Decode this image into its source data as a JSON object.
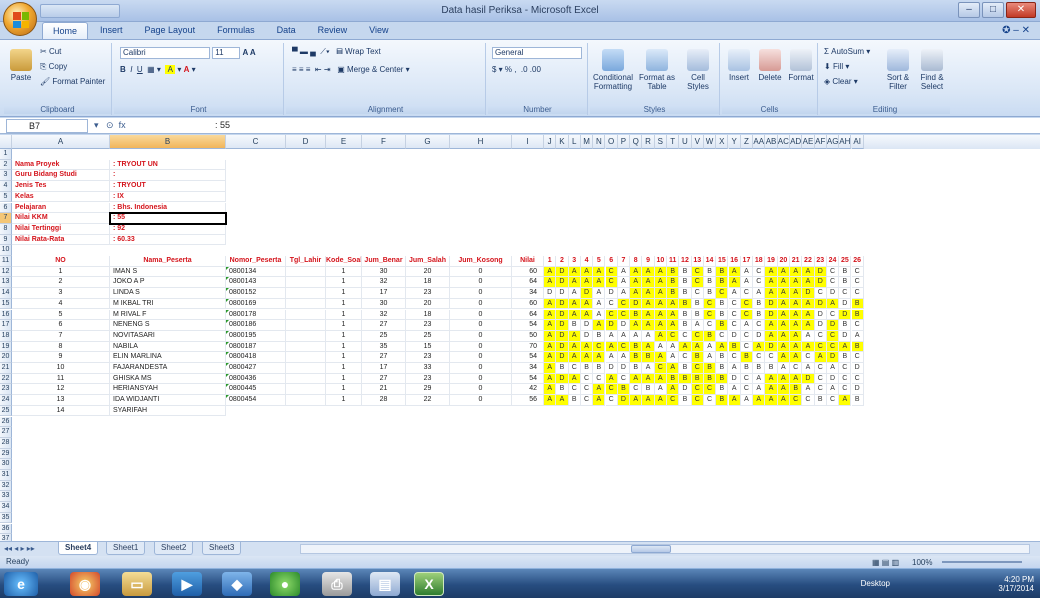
{
  "window": {
    "title": "Data hasil Periksa - Microsoft Excel",
    "controls": [
      "–",
      "□",
      "✕"
    ]
  },
  "ribbon": {
    "tabs": [
      "Home",
      "Insert",
      "Page Layout",
      "Formulas",
      "Data",
      "Review",
      "View"
    ],
    "active_tab": "Home",
    "help": "✪ – ✕",
    "clipboard": {
      "paste": "Paste",
      "cut": "Cut",
      "copy": "Copy",
      "format_painter": "Format Painter",
      "label": "Clipboard"
    },
    "font": {
      "name": "Calibri",
      "size": "11",
      "label": "Font"
    },
    "alignment": {
      "wrap": "Wrap Text",
      "merge": "Merge & Center",
      "label": "Alignment"
    },
    "number": {
      "format": "General",
      "label": "Number"
    },
    "styles": {
      "conditional": "Conditional Formatting",
      "format_table": "Format as Table",
      "cell_styles": "Cell Styles",
      "label": "Styles"
    },
    "cells": {
      "insert": "Insert",
      "delete": "Delete",
      "format": "Format",
      "label": "Cells"
    },
    "editing": {
      "autosum": "AutoSum",
      "fill": "Fill",
      "clear": "Clear",
      "sort": "Sort & Filter",
      "find": "Find & Select",
      "label": "Editing"
    }
  },
  "formula_bar": {
    "name_box": "B7",
    "fx": "fx",
    "value": ": 55"
  },
  "columns": [
    "A",
    "B",
    "C",
    "D",
    "E",
    "F",
    "G",
    "H",
    "I",
    "J",
    "K",
    "L",
    "M",
    "N",
    "O",
    "P",
    "Q",
    "R",
    "S",
    "T",
    "U",
    "V",
    "W",
    "X",
    "Y",
    "Z",
    "AA",
    "AB",
    "AC",
    "AD",
    "AE",
    "AF",
    "AG",
    "AH",
    "AI"
  ],
  "row_numbers": [
    1,
    2,
    3,
    4,
    5,
    6,
    7,
    8,
    9,
    10,
    11,
    12,
    13,
    14,
    15,
    16,
    17,
    18,
    19,
    20,
    21,
    22,
    23,
    24,
    25,
    26,
    27,
    28,
    29,
    30,
    31,
    32,
    33,
    34,
    35,
    36,
    37
  ],
  "info": [
    {
      "label": "Nama Proyek",
      "value": ": TRYOUT UN"
    },
    {
      "label": "Guru Bidang Studi",
      "value": ":"
    },
    {
      "label": "Jenis Tes",
      "value": ": TRYOUT"
    },
    {
      "label": "Kelas",
      "value": ": IX"
    },
    {
      "label": "Pelajaran",
      "value": ": Bhs. Indonesia"
    },
    {
      "label": "Nilai KKM",
      "value": ": 55"
    },
    {
      "label": "Nilai Tertinggi",
      "value": ": 92"
    },
    {
      "label": "Nilai Rata-Rata",
      "value": ": 60.33"
    }
  ],
  "table": {
    "headers": [
      "NO",
      "Nama_Peserta",
      "Nomor_Peserta",
      "Tgl_Lahir",
      "Kode_Soal",
      "Jum_Benar",
      "Jum_Salah",
      "Jum_Kosong",
      "Nilai"
    ],
    "question_numbers": [
      "1",
      "2",
      "3",
      "4",
      "5",
      "6",
      "7",
      "8",
      "9",
      "10",
      "11",
      "12",
      "13",
      "14",
      "15",
      "16",
      "17",
      "18",
      "19",
      "20",
      "21",
      "22",
      "23",
      "24",
      "25",
      "26"
    ],
    "rows": [
      {
        "no": "1",
        "name": "IMAN S",
        "nomor": "0800134",
        "kode": "1",
        "benar": "30",
        "salah": "20",
        "kosong": "0",
        "nilai": "60",
        "answers": "ADAAACAAAABBCBBAACAAAADCBCC",
        "hl": "11111101111010110011111000"
      },
      {
        "no": "2",
        "name": "JOKO A P",
        "nomor": "0800143",
        "kode": "1",
        "benar": "32",
        "salah": "18",
        "kosong": "0",
        "nilai": "64",
        "answers": "ADAAACAAAABBCBBAACAAAADCBCC",
        "hl": "11111101111010110011111000"
      },
      {
        "no": "3",
        "name": "LINDA S",
        "nomor": "0800152",
        "kode": "1",
        "benar": "17",
        "salah": "23",
        "kosong": "0",
        "nilai": "34",
        "answers": "DDADADAAAABBCBCACAAAADCDCCC",
        "hl": "00010001111000100011110000"
      },
      {
        "no": "4",
        "name": "M IKBAL TRI",
        "nomor": "0800169",
        "kode": "1",
        "benar": "30",
        "salah": "20",
        "kosong": "0",
        "nilai": "60",
        "answers": "ADAAACCDAAABBCBCCBDAAADADBCB",
        "hl": "11110011111101001011111101"
      },
      {
        "no": "5",
        "name": "M RIVAL F",
        "nomor": "0800178",
        "kode": "1",
        "benar": "32",
        "salah": "18",
        "kosong": "0",
        "nilai": "64",
        "answers": "ADAAACCBAAABBCBCCBDAAADCDBA",
        "hl": "11110111111001001011110011"
      },
      {
        "no": "6",
        "name": "NENENG S",
        "nomor": "0800186",
        "kode": "1",
        "benar": "27",
        "salah": "23",
        "kosong": "0",
        "nilai": "54",
        "answers": "ADBDADDAAAABACBCACAAAADDBCC",
        "hl": "11001101111000100011110100"
      },
      {
        "no": "7",
        "name": "NOVITASARI",
        "nomor": "0800195",
        "kode": "1",
        "benar": "25",
        "salah": "25",
        "kosong": "0",
        "nilai": "50",
        "answers": "ADADBAAAAACCCBCDCDAAAACCDA",
        "hl": "11100000011011000011100100"
      },
      {
        "no": "8",
        "name": "NABILA",
        "nomor": "0800187",
        "kode": "1",
        "benar": "35",
        "salah": "15",
        "kosong": "0",
        "nilai": "70",
        "answers": "ADAACACBAAAAAAABCADAAACCAB",
        "hl": "11111111100110110111111111"
      },
      {
        "no": "9",
        "name": "ELIN MARLINA",
        "nomor": "0800418",
        "kode": "1",
        "benar": "27",
        "salah": "23",
        "kosong": "0",
        "nilai": "54",
        "answers": "ADAAAAABBAACBABCBCCAACADBC",
        "hl": "11111001110010001001101100"
      },
      {
        "no": "10",
        "name": "FAJARANDESTA",
        "nomor": "0800427",
        "kode": "1",
        "benar": "17",
        "salah": "33",
        "kosong": "0",
        "nilai": "34",
        "answers": "ABCBBDDBACABCBBABBBACACACD",
        "hl": "10000000011011000000000000"
      },
      {
        "no": "11",
        "name": "GHISKA MS",
        "nomor": "0800436",
        "kode": "1",
        "benar": "27",
        "salah": "23",
        "kosong": "0",
        "nilai": "54",
        "answers": "ADACCACAAABBBBBDCAAAADCDCC",
        "hl": "11100101111111100011110000"
      },
      {
        "no": "12",
        "name": "HERIANSYAH",
        "nomor": "0800445",
        "kode": "1",
        "benar": "21",
        "salah": "29",
        "kosong": "0",
        "nilai": "42",
        "answers": "ABCCACBCBAADCCBACAAABACACD",
        "hl": "10001110001011000011100000"
      },
      {
        "no": "13",
        "name": "IDA WIDJANTI",
        "nomor": "0800454",
        "kode": "1",
        "benar": "28",
        "salah": "22",
        "kosong": "0",
        "nilai": "56",
        "answers": "AABCACDAAACBCCBAAAAACCBCAB",
        "hl": "11001011111010110111100010"
      }
    ]
  },
  "partial_row": {
    "no": "14",
    "name": "SYARIFAH"
  },
  "sheets": [
    "Sheet4",
    "Sheet1",
    "Sheet2",
    "Sheet3"
  ],
  "active_sheet": "Sheet4",
  "status": {
    "left": "Ready",
    "zoom": "100%"
  },
  "taskbar": {
    "desktop": "Desktop",
    "time": "4:20 PM",
    "date": "3/17/2014"
  }
}
